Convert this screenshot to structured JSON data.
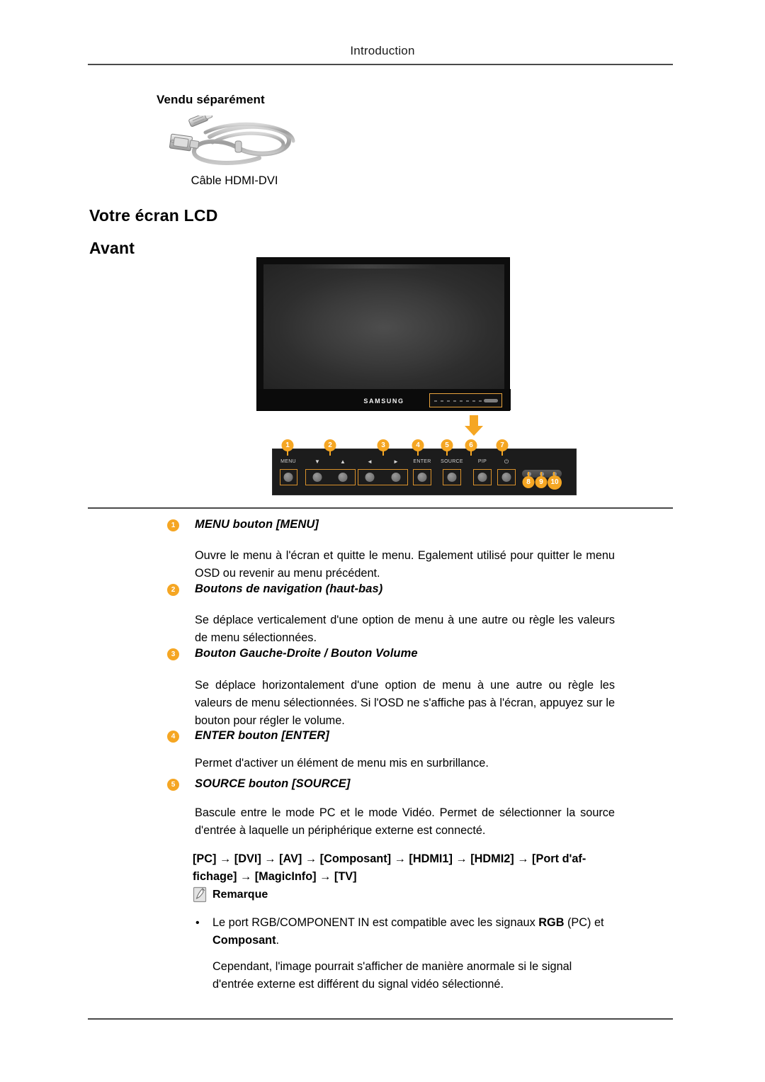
{
  "header": {
    "title": "Introduction"
  },
  "sold_separately": {
    "heading": "Vendu séparément",
    "cable_caption": "Câble HDMI-DVI",
    "cable_icon": "hdmi-dvi-cable-icon"
  },
  "headings": {
    "lcd": "Votre écran LCD",
    "front": "Avant"
  },
  "monitor": {
    "brand_logo": "SAMSUNG",
    "arrow_icon": "down-arrow-icon",
    "highlight_color": "#e8a33d"
  },
  "control_panel": {
    "buttons": [
      {
        "id": 1,
        "label": "MENU",
        "type": "text"
      },
      {
        "id": 2,
        "label": "▼",
        "label2": "▲",
        "type": "glyph-pair"
      },
      {
        "id": 3,
        "label": "◄",
        "label2": "►",
        "type": "glyph-pair"
      },
      {
        "id": 4,
        "label": "ENTER",
        "type": "text"
      },
      {
        "id": 5,
        "label": "SOURCE",
        "type": "text"
      },
      {
        "id": 6,
        "label": "PIP",
        "type": "text"
      },
      {
        "id": 7,
        "label": "⏻",
        "type": "glyph"
      }
    ],
    "callout_numbers": [
      "1",
      "2",
      "3",
      "4",
      "5",
      "6",
      "7",
      "8",
      "9",
      "10"
    ],
    "sensor_labels": [
      "8",
      "9",
      "10"
    ],
    "accent_color": "#f5a623"
  },
  "items": [
    {
      "num": "1",
      "title": "MENU bouton [MENU]",
      "body": "Ouvre le menu à l'écran et quitte le menu. Egalement utilisé pour quitter le menu OSD ou revenir au menu précédent."
    },
    {
      "num": "2",
      "title": "Boutons de navigation (haut-bas)",
      "body": "Se déplace verticalement d'une option de menu à une autre ou règle les valeurs de menu sélectionnées."
    },
    {
      "num": "3",
      "title": "Bouton Gauche-Droite / Bouton Volume",
      "body": "Se déplace horizontalement d'une option de menu à une autre ou règle les valeurs de menu sélectionnées. Si l'OSD ne s'affiche pas à l'écran, appuyez sur le bouton pour régler le volume."
    },
    {
      "num": "4",
      "title": "ENTER bouton [ENTER]",
      "body": "Permet d'activer un élément de menu mis en surbrillance."
    },
    {
      "num": "5",
      "title": "SOURCE bouton [SOURCE]",
      "body": "Bascule entre le mode PC et le mode Vidéo. Permet de sélectionner la source d'entrée à laquelle un périphérique externe est connecté."
    }
  ],
  "source_chain": {
    "line1": "[PC] → [DVI] → [AV] → [Composant] → [HDMI1] → [HDMI2] → [Port d'af-",
    "line2": "fichage] → [MagicInfo] → [TV]"
  },
  "note": {
    "icon": "note-pencil-icon",
    "label": "Remarque",
    "bullet_marker": "•",
    "bullet_html": "Le port RGB/COMPONENT IN est compatible avec les signaux <b>RGB</b> (PC) et <b>Composant</b>.",
    "paragraph": "Cependant, l'image pourrait s'afficher de manière anormale si le signal d'entrée externe est différent du signal vidéo sélectionné."
  }
}
